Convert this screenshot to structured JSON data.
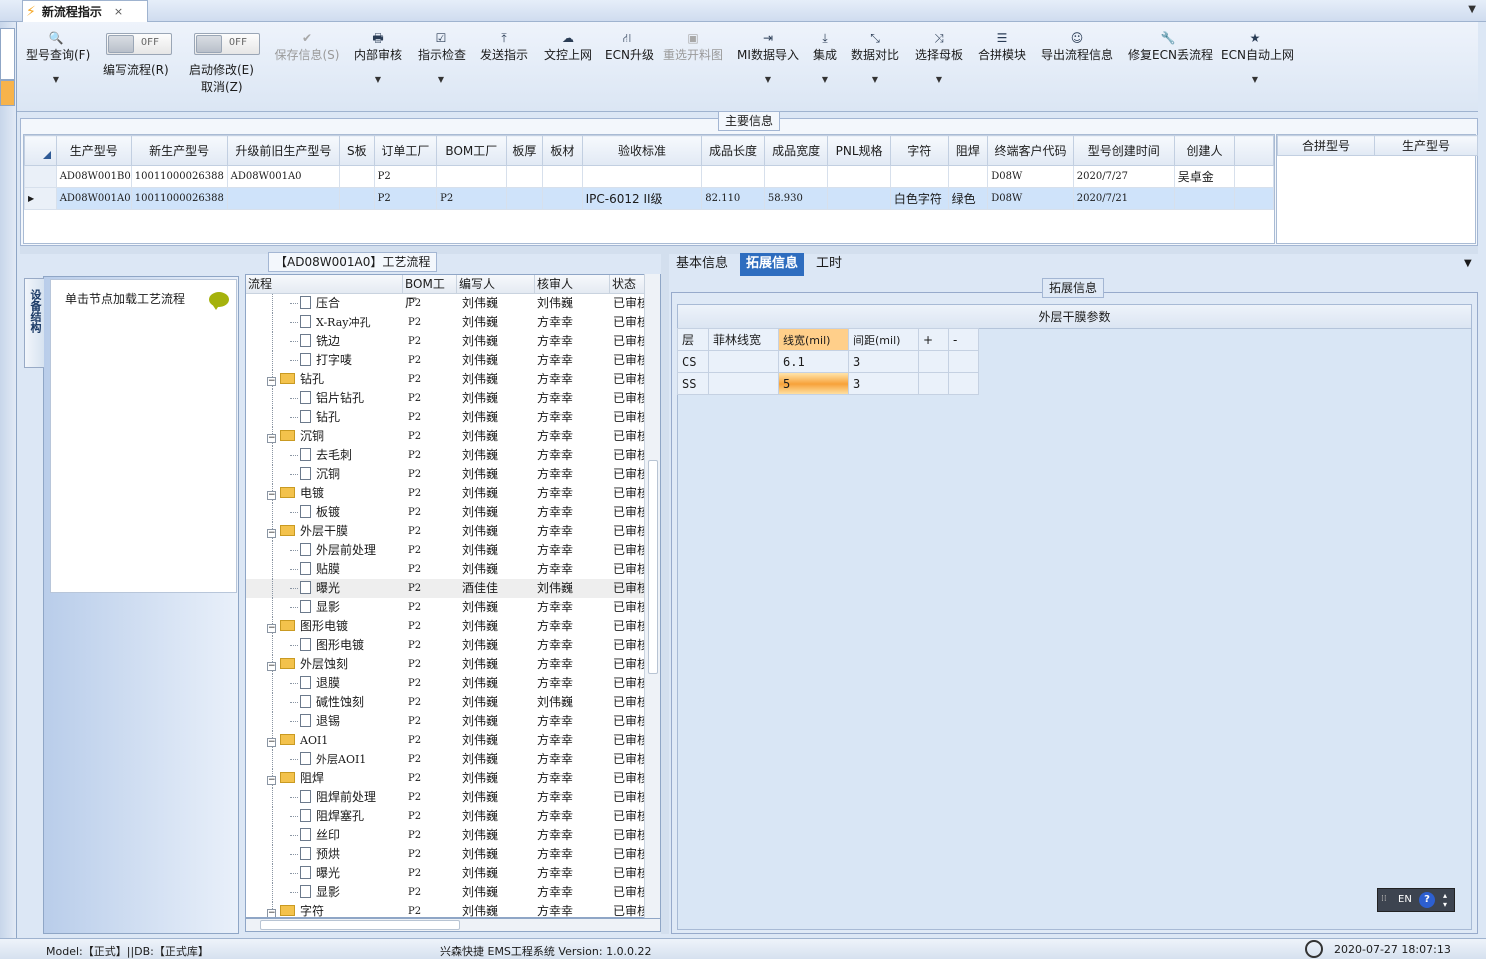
{
  "app": {
    "tab_title": "新流程指示",
    "tab_close": "×",
    "collapse": "▼"
  },
  "ribbon": {
    "buttons": [
      {
        "label": "型号查询(F)",
        "icon": "search-icon",
        "glyph": "🔍",
        "disabled": false,
        "dropdown": true
      },
      {
        "label": "保存信息(S)",
        "icon": "check-icon",
        "glyph": "✔",
        "disabled": true,
        "dropdown": false
      },
      {
        "label": "内部审核",
        "icon": "printer-icon",
        "glyph": "🖶",
        "disabled": false,
        "dropdown": true
      },
      {
        "label": "指示检查",
        "icon": "checkbox-icon",
        "glyph": "☑",
        "disabled": false,
        "dropdown": true
      },
      {
        "label": "发送指示",
        "icon": "upload-icon",
        "glyph": "⤒",
        "disabled": false,
        "dropdown": false
      },
      {
        "label": "文控上网",
        "icon": "cloud-upload-icon",
        "glyph": "☁",
        "disabled": false,
        "dropdown": false
      },
      {
        "label": "ECN升级",
        "icon": "road-icon",
        "glyph": "⛙",
        "disabled": false,
        "dropdown": false
      },
      {
        "label": "重选开料图",
        "icon": "image-icon",
        "glyph": "▣",
        "disabled": true,
        "dropdown": false
      },
      {
        "label": "MI数据导入",
        "icon": "sign-in-icon",
        "glyph": "⇥",
        "disabled": false,
        "dropdown": true
      },
      {
        "label": "集成",
        "icon": "download-icon",
        "glyph": "⤓",
        "disabled": false,
        "dropdown": true
      },
      {
        "label": "数据对比",
        "icon": "compress-icon",
        "glyph": "⤡",
        "disabled": false,
        "dropdown": true
      },
      {
        "label": "选择母板",
        "icon": "shuffle-icon",
        "glyph": "⤨",
        "disabled": false,
        "dropdown": true
      },
      {
        "label": "合拼模块",
        "icon": "list-icon",
        "glyph": "☰",
        "disabled": false,
        "dropdown": false
      },
      {
        "label": "导出流程信息",
        "icon": "smile-icon",
        "glyph": "☺",
        "disabled": false,
        "dropdown": false
      },
      {
        "label": "修复ECN丢流程",
        "icon": "wrench-icon",
        "glyph": "🔧",
        "disabled": false,
        "dropdown": false
      },
      {
        "label": "ECN自动上网",
        "icon": "star-icon",
        "glyph": "★",
        "disabled": false,
        "dropdown": true
      }
    ],
    "toggles": [
      {
        "state": "OFF",
        "label": "编写流程(R)"
      },
      {
        "state": "OFF",
        "label": "启动修改(E)",
        "sub": "取消(Z)"
      }
    ]
  },
  "main_info": {
    "title": "主要信息",
    "columns": [
      "生产型号",
      "新生产型号",
      "升级前旧生产型号",
      "S板",
      "订单工厂",
      "BOM工厂",
      "板厚",
      "板材",
      "验收标准",
      "成品长度",
      "成品宽度",
      "PNL规格",
      "字符",
      "阻焊",
      "终端客户代码",
      "型号创建时间",
      "创建人"
    ],
    "rows": [
      [
        "AD08W001B0",
        "10011000026388",
        "AD08W001A0",
        "",
        "P2",
        "",
        "",
        "",
        "",
        "",
        "",
        "",
        "",
        "",
        "D08W",
        "2020/7/27",
        "吴卓金"
      ],
      [
        "AD08W001A0",
        "10011000026388",
        "",
        "",
        "P2",
        "P2",
        "",
        "",
        "IPC-6012 II级",
        "82.110",
        "58.930",
        "",
        "白色字符",
        "绿色",
        "D08W",
        "2020/7/21",
        ""
      ]
    ],
    "selected_row": 1,
    "side_columns": [
      "合拼型号",
      "生产型号"
    ]
  },
  "left_panel": {
    "vertical_tab": "设备结构",
    "load_hint": "单击节点加载工艺流程"
  },
  "process": {
    "title": "【AD08W001A0】工艺流程",
    "columns": [
      "流程",
      "BOM工厂",
      "编写人",
      "核审人",
      "状态"
    ],
    "rows": [
      {
        "name": "压合",
        "type": "doc",
        "bom": "P2",
        "writer": "刘伟巍",
        "checker": "刘伟巍",
        "status": "已审核"
      },
      {
        "name": "X-Ray冲孔",
        "type": "doc",
        "bom": "P2",
        "writer": "刘伟巍",
        "checker": "方幸幸",
        "status": "已审核"
      },
      {
        "name": "铣边",
        "type": "doc",
        "bom": "P2",
        "writer": "刘伟巍",
        "checker": "方幸幸",
        "status": "已审核"
      },
      {
        "name": "打字唛",
        "type": "doc",
        "bom": "P2",
        "writer": "刘伟巍",
        "checker": "方幸幸",
        "status": "已审核"
      },
      {
        "name": "钻孔",
        "type": "folder",
        "bom": "P2",
        "writer": "刘伟巍",
        "checker": "方幸幸",
        "status": "已审核"
      },
      {
        "name": "铝片钻孔",
        "type": "doc",
        "bom": "P2",
        "writer": "刘伟巍",
        "checker": "方幸幸",
        "status": "已审核"
      },
      {
        "name": "钻孔",
        "type": "doc",
        "bom": "P2",
        "writer": "刘伟巍",
        "checker": "方幸幸",
        "status": "已审核"
      },
      {
        "name": "沉铜",
        "type": "folder",
        "bom": "P2",
        "writer": "刘伟巍",
        "checker": "方幸幸",
        "status": "已审核"
      },
      {
        "name": "去毛刺",
        "type": "doc",
        "bom": "P2",
        "writer": "刘伟巍",
        "checker": "方幸幸",
        "status": "已审核"
      },
      {
        "name": "沉铜",
        "type": "doc",
        "bom": "P2",
        "writer": "刘伟巍",
        "checker": "方幸幸",
        "status": "已审核"
      },
      {
        "name": "电镀",
        "type": "folder",
        "bom": "P2",
        "writer": "刘伟巍",
        "checker": "方幸幸",
        "status": "已审核"
      },
      {
        "name": "板镀",
        "type": "doc",
        "bom": "P2",
        "writer": "刘伟巍",
        "checker": "方幸幸",
        "status": "已审核"
      },
      {
        "name": "外层干膜",
        "type": "folder",
        "bom": "P2",
        "writer": "刘伟巍",
        "checker": "方幸幸",
        "status": "已审核"
      },
      {
        "name": "外层前处理",
        "type": "doc",
        "bom": "P2",
        "writer": "刘伟巍",
        "checker": "方幸幸",
        "status": "已审核"
      },
      {
        "name": "贴膜",
        "type": "doc",
        "bom": "P2",
        "writer": "刘伟巍",
        "checker": "方幸幸",
        "status": "已审核"
      },
      {
        "name": "曝光",
        "type": "doc",
        "bom": "P2",
        "writer": "酒佳佳",
        "checker": "刘伟巍",
        "status": "已审核",
        "highlight": true
      },
      {
        "name": "显影",
        "type": "doc",
        "bom": "P2",
        "writer": "刘伟巍",
        "checker": "方幸幸",
        "status": "已审核"
      },
      {
        "name": "图形电镀",
        "type": "folder",
        "bom": "P2",
        "writer": "刘伟巍",
        "checker": "方幸幸",
        "status": "已审核"
      },
      {
        "name": "图形电镀",
        "type": "doc",
        "bom": "P2",
        "writer": "刘伟巍",
        "checker": "方幸幸",
        "status": "已审核"
      },
      {
        "name": "外层蚀刻",
        "type": "folder",
        "bom": "P2",
        "writer": "刘伟巍",
        "checker": "方幸幸",
        "status": "已审核"
      },
      {
        "name": "退膜",
        "type": "doc",
        "bom": "P2",
        "writer": "刘伟巍",
        "checker": "方幸幸",
        "status": "已审核"
      },
      {
        "name": "碱性蚀刻",
        "type": "doc",
        "bom": "P2",
        "writer": "刘伟巍",
        "checker": "刘伟巍",
        "status": "已审核"
      },
      {
        "name": "退锡",
        "type": "doc",
        "bom": "P2",
        "writer": "刘伟巍",
        "checker": "方幸幸",
        "status": "已审核"
      },
      {
        "name": "AOI1",
        "type": "folder",
        "bom": "P2",
        "writer": "刘伟巍",
        "checker": "方幸幸",
        "status": "已审核"
      },
      {
        "name": "外层AOI1",
        "type": "doc",
        "bom": "P2",
        "writer": "刘伟巍",
        "checker": "方幸幸",
        "status": "已审核"
      },
      {
        "name": "阻焊",
        "type": "folder",
        "bom": "P2",
        "writer": "刘伟巍",
        "checker": "方幸幸",
        "status": "已审核"
      },
      {
        "name": "阻焊前处理",
        "type": "doc",
        "bom": "P2",
        "writer": "刘伟巍",
        "checker": "方幸幸",
        "status": "已审核"
      },
      {
        "name": "阻焊塞孔",
        "type": "doc",
        "bom": "P2",
        "writer": "刘伟巍",
        "checker": "方幸幸",
        "status": "已审核"
      },
      {
        "name": "丝印",
        "type": "doc",
        "bom": "P2",
        "writer": "刘伟巍",
        "checker": "方幸幸",
        "status": "已审核"
      },
      {
        "name": "预烘",
        "type": "doc",
        "bom": "P2",
        "writer": "刘伟巍",
        "checker": "方幸幸",
        "status": "已审核"
      },
      {
        "name": "曝光",
        "type": "doc",
        "bom": "P2",
        "writer": "刘伟巍",
        "checker": "方幸幸",
        "status": "已审核"
      },
      {
        "name": "显影",
        "type": "doc",
        "bom": "P2",
        "writer": "刘伟巍",
        "checker": "方幸幸",
        "status": "已审核"
      },
      {
        "name": "字符",
        "type": "folder",
        "bom": "P2",
        "writer": "刘伟巍",
        "checker": "方幸幸",
        "status": "已审核"
      }
    ]
  },
  "right_panel": {
    "tabs": [
      "基本信息",
      "拓展信息",
      "工时"
    ],
    "active_tab": 1,
    "group_title": "拓展信息",
    "param_title": "外层干膜参数",
    "param_columns": [
      "层",
      "菲林线宽",
      "线宽(mil)",
      "间距(mil)",
      "+",
      "-"
    ],
    "param_rows": [
      [
        "CS",
        "",
        "6.1",
        "3",
        "",
        ""
      ],
      [
        "SS",
        "",
        "5",
        "3",
        "",
        ""
      ]
    ]
  },
  "lang_bar": {
    "lang": "EN",
    "help": "?"
  },
  "statusbar": {
    "left": "Model:【正式】||DB:【正式库】",
    "center": "兴森快捷 EMS工程系统 Version: 1.0.0.22",
    "datetime": "2020-07-27 18:07:13"
  }
}
